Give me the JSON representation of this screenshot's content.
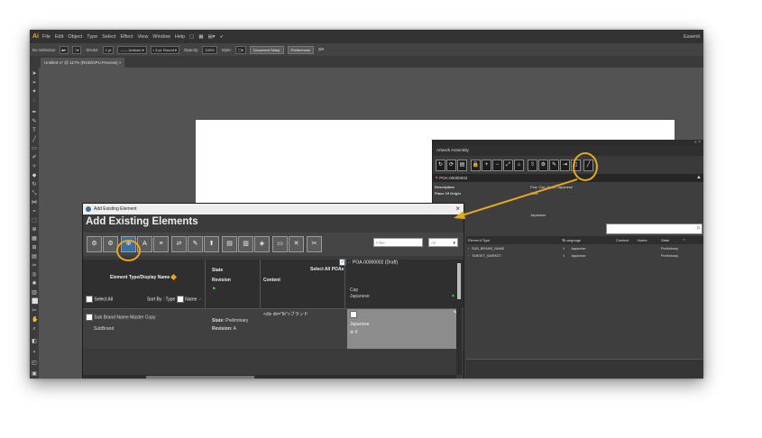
{
  "app": {
    "logo": "Ai",
    "menu": [
      "File",
      "Edit",
      "Object",
      "Type",
      "Select",
      "Effect",
      "View",
      "Window",
      "Help"
    ],
    "right_label": "Essenti"
  },
  "control_bar": {
    "selection": "No Selection",
    "stroke_label": "Stroke:",
    "stroke_value": "1 pt",
    "uniform": "Uniform",
    "round": "3 pt. Round",
    "opacity_label": "Opacity:",
    "opacity_value": "100%",
    "style_label": "Style:",
    "doc_setup": "Document Setup",
    "preferences": "Preferences"
  },
  "document_tab": "Untitled-1* @ 117% (RGB/GPU Preview)",
  "artwork_assembly": {
    "title": "Artwork Assembly",
    "poa": "POA-00000002",
    "fields": [
      {
        "key": "Description",
        "value": "Poa: Cap Japan Japanese"
      },
      {
        "key": "Place Of Origin",
        "value": "Cota"
      },
      {
        "key": "",
        "value": "Japanese"
      }
    ],
    "columns": [
      "Element Type",
      "Language",
      "Content",
      "Notes",
      "State"
    ],
    "rows": [
      {
        "type": "SUB_BRAND_NAME",
        "count": "1",
        "language": "Japanese",
        "state": "Preliminary"
      },
      {
        "type": "TARGET_MARKET",
        "count": "1",
        "language": "Japanese",
        "state": "Preliminary"
      }
    ]
  },
  "dialog": {
    "title": "Add Existing Element",
    "heading": "Add Existing Elements",
    "filter_placeholder": "Filter",
    "select_value": "All",
    "headers": {
      "element_type": "Element Type/Display Name",
      "state": "State",
      "revision": "Revision",
      "content": "Content",
      "select_all_poas": "Select All POAs",
      "poa_draft": "POA-00000002 (Draft)",
      "select_all": "Select All",
      "sort_by": "Sort By : Type",
      "name": "Name",
      "poa_cap": "Cap",
      "poa_lang": "Japanese"
    },
    "row": {
      "name": "Sub Brand Name Master Copy",
      "subtype": "SubBrand",
      "state_label": "State:",
      "state_value": "Preliminary",
      "revision_label": "Revision:",
      "revision_value": "A",
      "content": "<div dir=\"ltr\">ブランド",
      "poa_lang": "Japanese",
      "poa_count": "0"
    }
  },
  "colors": {
    "highlight": "#e8a819",
    "panel_bg": "#3b3b3b",
    "accent_blue": "#1c6fd0"
  }
}
